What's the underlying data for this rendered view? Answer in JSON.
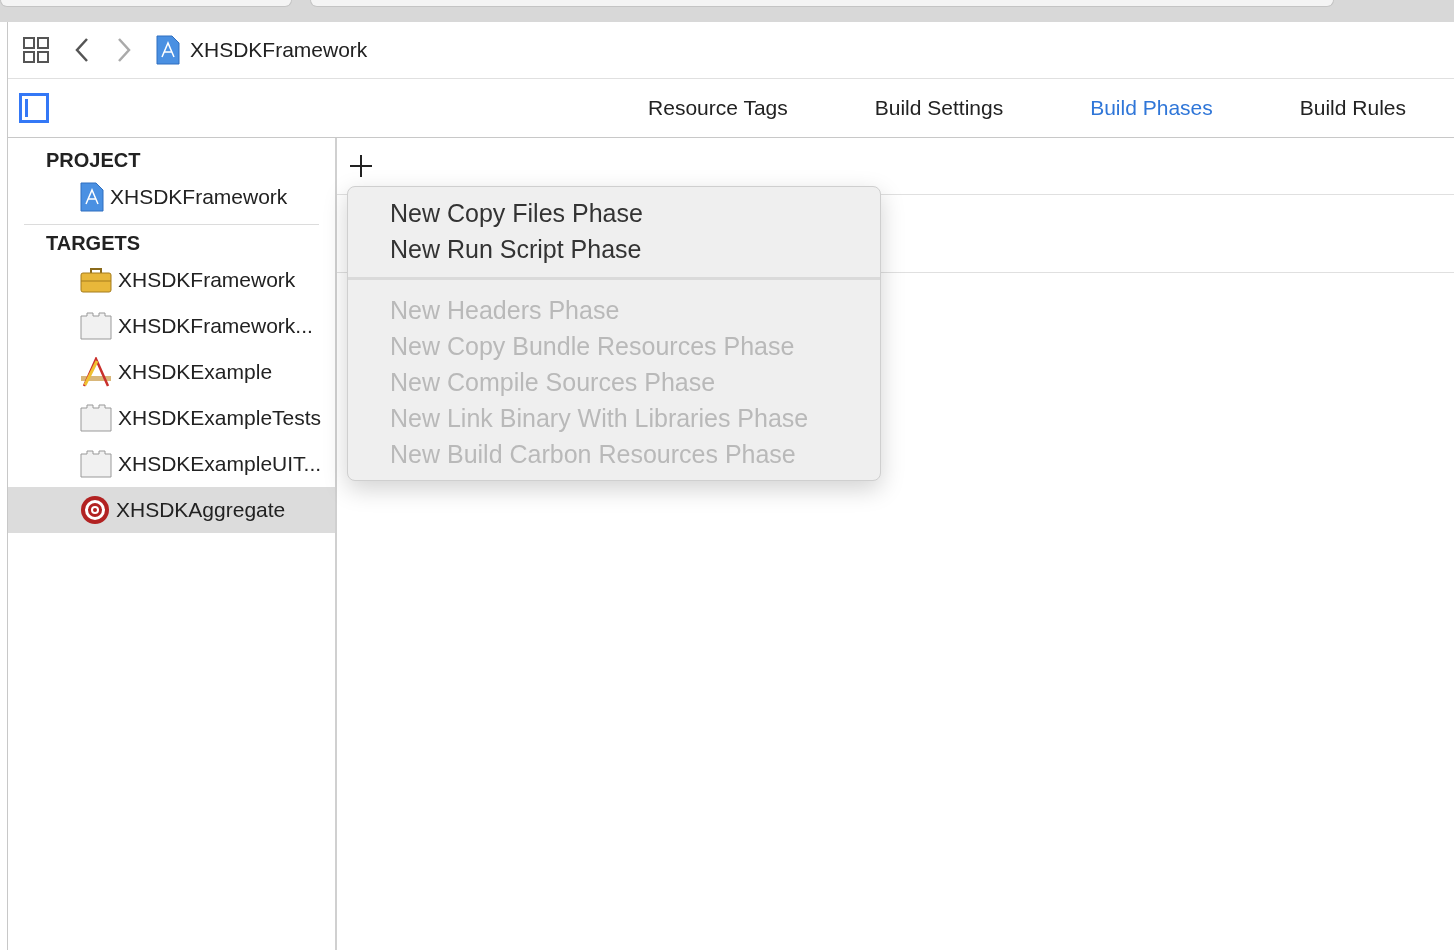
{
  "path_bar": {
    "project": "XHSDKFramework"
  },
  "tabs": [
    {
      "label": "Resource Tags",
      "selected": false
    },
    {
      "label": "Build Settings",
      "selected": false
    },
    {
      "label": "Build Phases",
      "selected": true
    },
    {
      "label": "Build Rules",
      "selected": false
    }
  ],
  "sidebar": {
    "sections": [
      {
        "title": "PROJECT",
        "items": [
          {
            "label": "XHSDKFramework",
            "kind": "project",
            "selected": false
          }
        ]
      },
      {
        "title": "TARGETS",
        "items": [
          {
            "label": "XHSDKFramework",
            "kind": "toolbox",
            "selected": false
          },
          {
            "label": "XHSDKFramework...",
            "kind": "bundle",
            "selected": false
          },
          {
            "label": "XHSDKExample",
            "kind": "app",
            "selected": false
          },
          {
            "label": "XHSDKExampleTests",
            "kind": "bundle",
            "selected": false
          },
          {
            "label": "XHSDKExampleUIT...",
            "kind": "bundle",
            "selected": false
          },
          {
            "label": "XHSDKAggregate",
            "kind": "aggregate",
            "selected": true
          }
        ]
      }
    ]
  },
  "menu": {
    "groups": [
      [
        {
          "label": "New Copy Files Phase",
          "disabled": false
        },
        {
          "label": "New Run Script Phase",
          "disabled": false
        }
      ],
      [
        {
          "label": "New Headers Phase",
          "disabled": true
        },
        {
          "label": "New Copy Bundle Resources Phase",
          "disabled": true
        },
        {
          "label": "New Compile Sources Phase",
          "disabled": true
        },
        {
          "label": "New Link Binary With Libraries Phase",
          "disabled": true
        },
        {
          "label": "New Build Carbon Resources Phase",
          "disabled": true
        }
      ]
    ]
  }
}
